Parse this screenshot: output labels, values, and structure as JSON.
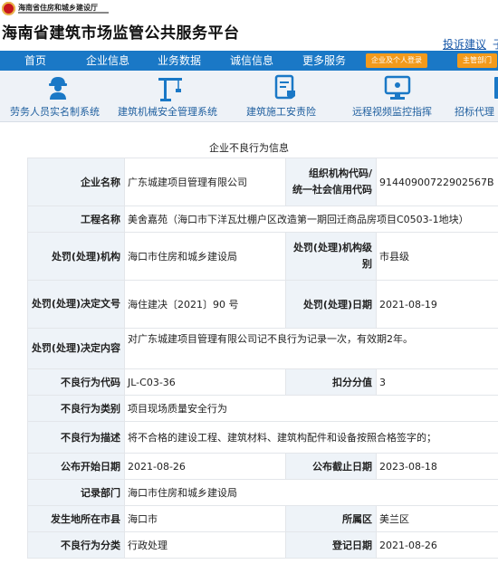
{
  "header": {
    "department": "海南省住房和城乡建设厅",
    "title": "海南省建筑市场监管公共服务平台",
    "complaint_link": "投诉建议",
    "complaint_link_tail": "子"
  },
  "nav": {
    "items": [
      "首页",
      "企业信息",
      "业务数据",
      "诚信信息",
      "更多服务"
    ],
    "buttons": [
      "企业及个人登录",
      "主管部门"
    ]
  },
  "systems": [
    {
      "label": "劳务人员实名制系统",
      "icon": "worker-icon"
    },
    {
      "label": "建筑机械安全管理系统",
      "icon": "crane-icon"
    },
    {
      "label": "建筑施工安责险",
      "icon": "insurance-doc-icon"
    },
    {
      "label": "远程视频监控指挥",
      "icon": "monitor-icon"
    },
    {
      "label": "招标代理",
      "icon": "bid-icon"
    }
  ],
  "record": {
    "section_title": "企业不良行为信息",
    "fields": {
      "company_name_label": "企业名称",
      "company_name": "广东城建项目管理有限公司",
      "org_code_label_1": "组织机构代码/",
      "org_code_label_2": "统一社会信用代码",
      "org_code": "91440900722902567B",
      "project_label": "工程名称",
      "project": "美舍嘉苑（海口市下洋瓦灶棚户区改造第一期回迁商品房项目C0503-1地块）",
      "authority_label": "处罚(处理)机构",
      "authority": "海口市住房和城乡建设局",
      "authority_level_label": "处罚(处理)机构级别",
      "authority_level": "市县级",
      "decision_no_label": "处罚(处理)决定文号",
      "decision_no": "海住建决〔2021〕90 号",
      "decision_date_label": "处罚(处理)日期",
      "decision_date": "2021-08-19",
      "decision_content_label": "处罚(处理)决定内容",
      "decision_content": "对广东城建项目管理有限公司记不良行为记录一次，有效期2年。",
      "behavior_code_label": "不良行为代码",
      "behavior_code": "JL-C03-36",
      "points_label": "扣分分值",
      "points": "3",
      "category_label": "不良行为类别",
      "category": "项目现场质量安全行为",
      "description_label": "不良行为描述",
      "description": "将不合格的建设工程、建筑材料、建筑构配件和设备按照合格签字的；",
      "publish_start_label": "公布开始日期",
      "publish_start": "2021-08-26",
      "publish_end_label": "公布截止日期",
      "publish_end": "2023-08-18",
      "recorder_label": "记录部门",
      "recorder": "海口市住房和城乡建设局",
      "city_label": "发生地所在市县",
      "city": "海口市",
      "district_label": "所属区",
      "district": "美兰区",
      "classification_label": "不良行为分类",
      "classification": "行政处理",
      "register_date_label": "登记日期",
      "register_date": "2021-08-26"
    }
  }
}
